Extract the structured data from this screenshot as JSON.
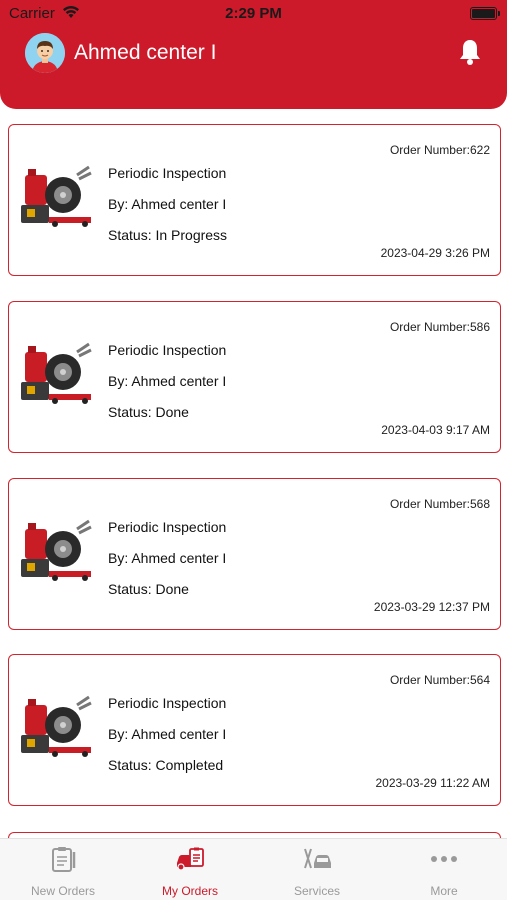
{
  "status_bar": {
    "carrier": "Carrier",
    "time": "2:29 PM"
  },
  "header": {
    "title": "Ahmed center I"
  },
  "orders": [
    {
      "order_number": "Order Number:622",
      "title": "Periodic Inspection",
      "by": "By:  Ahmed center I",
      "status": "Status:  In Progress",
      "date": "2023-04-29 3:26 PM"
    },
    {
      "order_number": "Order Number:586",
      "title": "Periodic Inspection",
      "by": "By:  Ahmed center I",
      "status": "Status:  Done",
      "date": "2023-04-03 9:17 AM"
    },
    {
      "order_number": "Order Number:568",
      "title": "Periodic Inspection",
      "by": "By:  Ahmed center I",
      "status": "Status:  Done",
      "date": "2023-03-29 12:37 PM"
    },
    {
      "order_number": "Order Number:564",
      "title": "Periodic Inspection",
      "by": "By:  Ahmed center I",
      "status": "Status:  Completed",
      "date": "2023-03-29 11:22 AM"
    }
  ],
  "tabs": [
    {
      "label": "New Orders",
      "icon": "clipboard-icon"
    },
    {
      "label": "My Orders",
      "icon": "car-order-icon",
      "active": true
    },
    {
      "label": "Services",
      "icon": "tools-car-icon"
    },
    {
      "label": "More",
      "icon": "more-dots-icon"
    }
  ],
  "colors": {
    "brand": "#cc1a2b",
    "tab_inactive": "#9a9a9a"
  }
}
